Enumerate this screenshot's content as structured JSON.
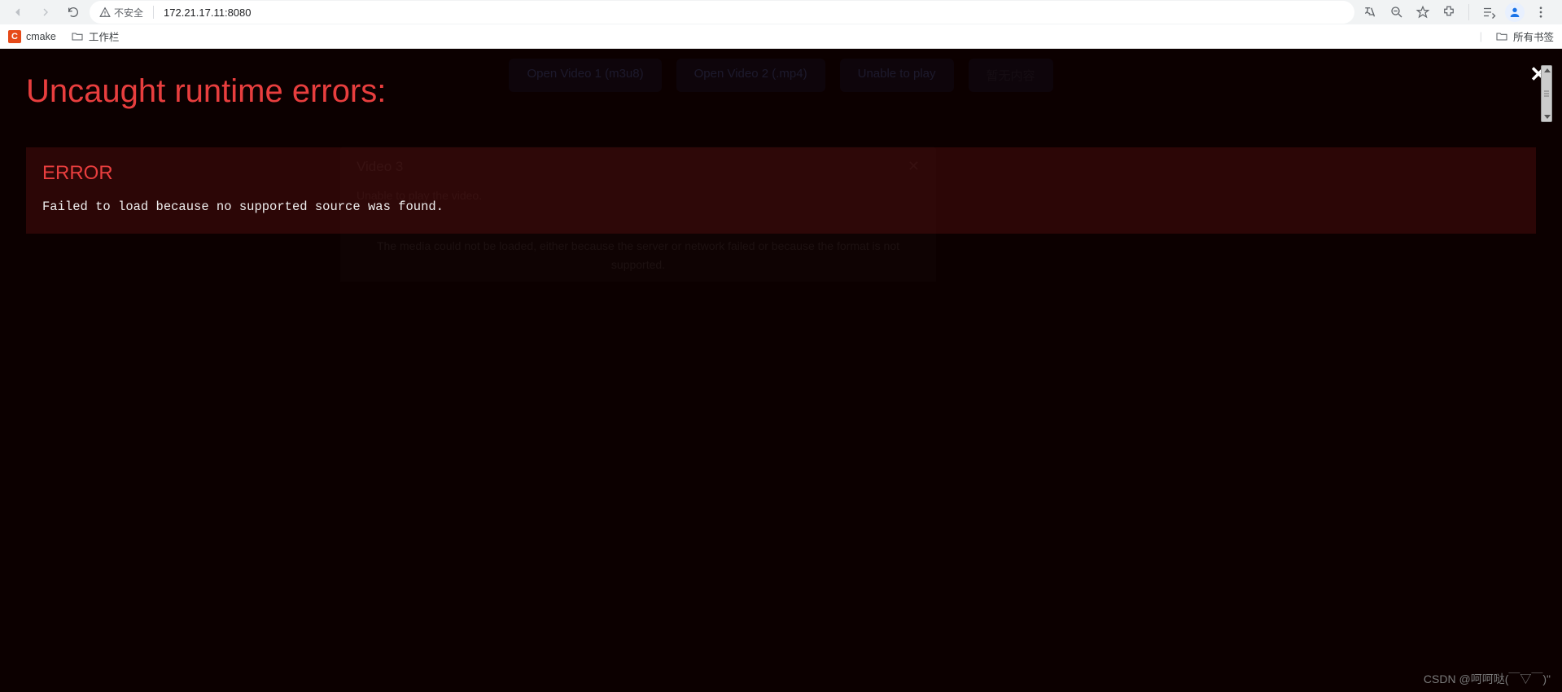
{
  "chrome": {
    "insecure_label": "不安全",
    "url": "172.21.17.11:8080"
  },
  "bookmarks": {
    "items": [
      {
        "icon_letter": "C",
        "label": "cmake"
      },
      {
        "icon_letter": "",
        "label": "工作栏"
      }
    ],
    "all_label": "所有书签"
  },
  "app": {
    "tabs": [
      {
        "label": "Open Video 1 (m3u8)",
        "muted": false
      },
      {
        "label": "Open Video 2 (.mp4)",
        "muted": false
      },
      {
        "label": "Unable to play",
        "muted": false
      },
      {
        "label": "暂无内容",
        "muted": true
      }
    ],
    "modal": {
      "title": "Video 3",
      "line1": "Unable to play the video.",
      "line2": "The media could not be loaded, either because the server or network failed or because the format is not supported."
    }
  },
  "overlay": {
    "title": "Uncaught runtime errors:",
    "errors": [
      {
        "heading": "ERROR",
        "message": "Failed to load because no supported source was found."
      }
    ]
  },
  "watermark": "CSDN @呵呵哒(￣▽￣)\""
}
